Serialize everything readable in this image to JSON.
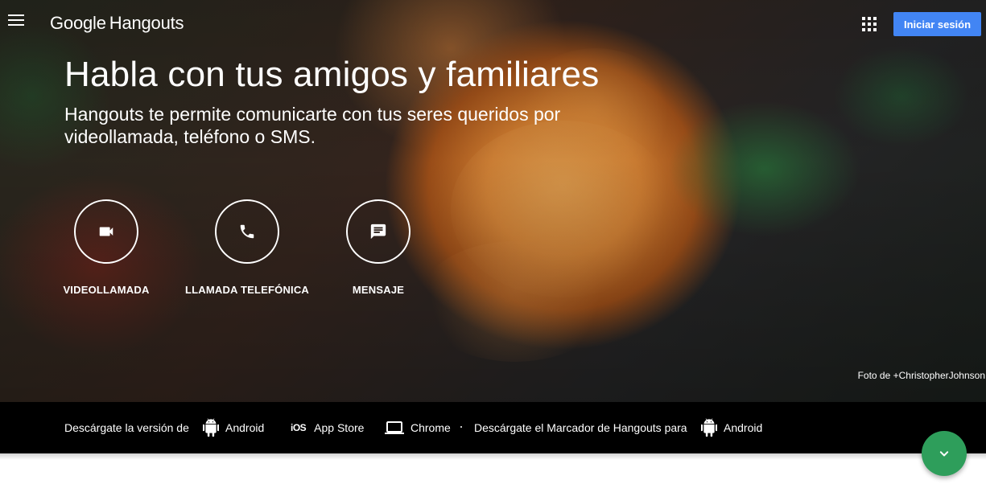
{
  "app": {
    "logo_google": "Google",
    "logo_product": "Hangouts"
  },
  "header": {
    "signin_label": "Iniciar sesión",
    "menu_icon": "hamburger-menu-icon",
    "apps_icon": "apps-grid-icon"
  },
  "hero": {
    "headline": "Habla con tus amigos y familiares",
    "subline": "Hangouts te permite comunicarte con tus seres queridos por videollamada, teléfono o SMS.",
    "photo_credit": "Foto de +ChristopherJohnson"
  },
  "actions": [
    {
      "label": "VIDEOLLAMADA",
      "icon": "videocam-icon"
    },
    {
      "label": "LLAMADA TELEFÓNICA",
      "icon": "phone-icon"
    },
    {
      "label": "MENSAJE",
      "icon": "chat-message-icon"
    }
  ],
  "downloads": {
    "intro": "Descárgate la versión de",
    "android_label": "Android",
    "ios_label": "App Store",
    "ios_glyph": "iOS",
    "chrome_label": "Chrome",
    "dialer_intro": "Descárgate el Marcador de Hangouts para",
    "dialer_android_label": "Android"
  },
  "colors": {
    "signin_bg": "#4285f4",
    "fab_bg": "#2e9e5b",
    "download_bar_bg": "#000000"
  },
  "fab": {
    "icon": "chevron-down-icon"
  }
}
